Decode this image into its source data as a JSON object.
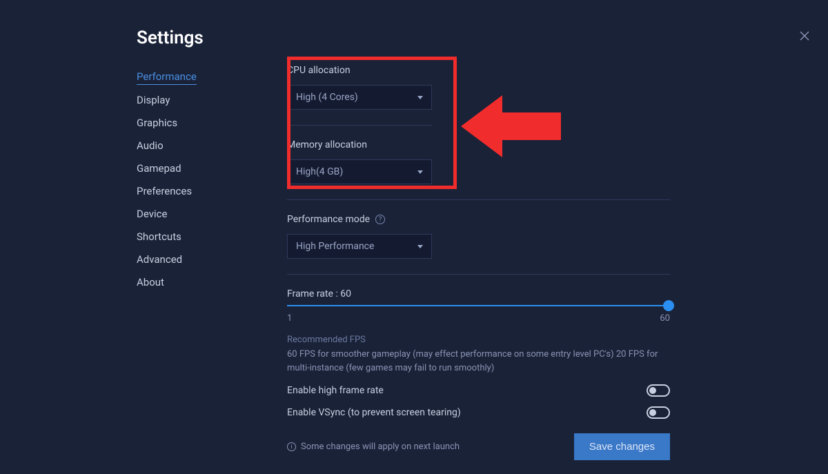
{
  "title": "Settings",
  "sidebar": {
    "items": [
      {
        "label": "Performance",
        "active": true
      },
      {
        "label": "Display"
      },
      {
        "label": "Graphics"
      },
      {
        "label": "Audio"
      },
      {
        "label": "Gamepad"
      },
      {
        "label": "Preferences"
      },
      {
        "label": "Device"
      },
      {
        "label": "Shortcuts"
      },
      {
        "label": "Advanced"
      },
      {
        "label": "About"
      }
    ]
  },
  "cpu": {
    "label": "CPU allocation",
    "value": "High (4 Cores)"
  },
  "memory": {
    "label": "Memory allocation",
    "value": "High(4 GB)"
  },
  "perfmode": {
    "label": "Performance mode",
    "value": "High Performance"
  },
  "framerate": {
    "label": "Frame rate : 60",
    "min": "1",
    "max": "60",
    "value": 60
  },
  "recommended": {
    "title": "Recommended FPS",
    "text": "60 FPS for smoother gameplay (may effect performance on some entry level PC's) 20 FPS for multi-instance (few games may fail to run smoothly)"
  },
  "toggles": {
    "highframe": "Enable high frame rate",
    "vsync": "Enable VSync (to prevent screen tearing)"
  },
  "footer": {
    "note": "Some changes will apply on next launch",
    "save": "Save changes"
  }
}
